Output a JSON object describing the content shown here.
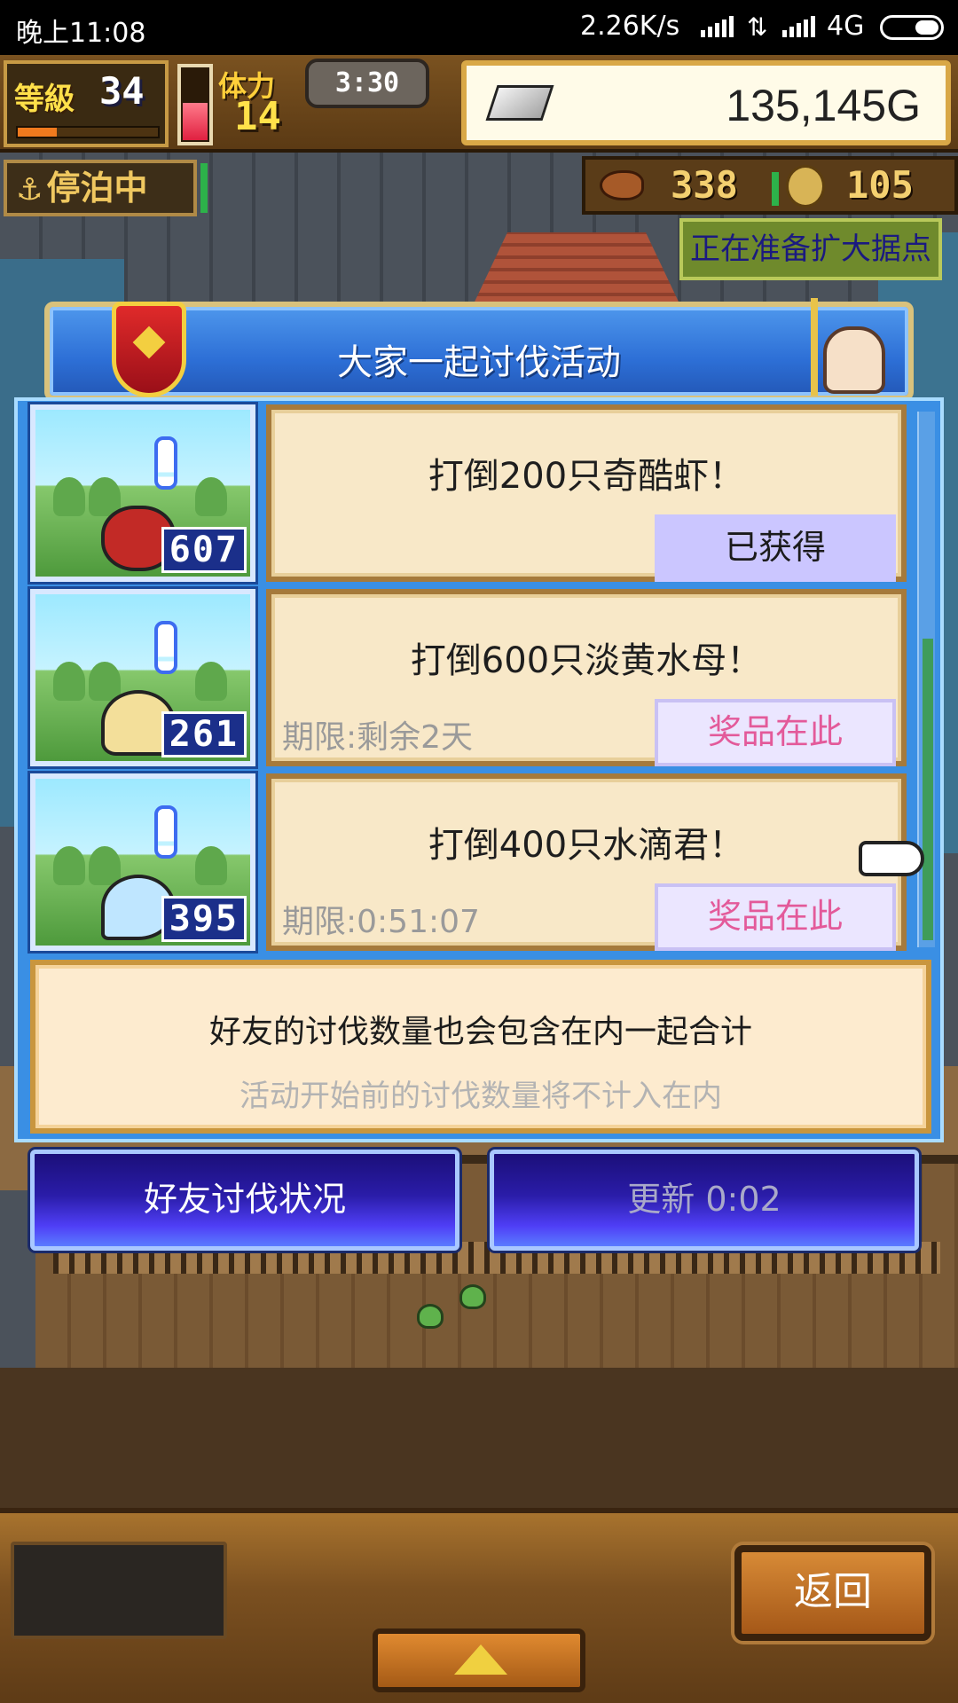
{
  "status_bar": {
    "time": "晚上11:08",
    "net_speed": "2.26K/s",
    "network_type": "4G"
  },
  "hud": {
    "level_label": "等級",
    "level": "34",
    "exp_progress": 0.28,
    "stamina_label": "体力",
    "stamina": "14",
    "stamina_progress": 0.55,
    "stamina_timer": "3:30",
    "gold": "135,145G",
    "docked_label": "停泊中",
    "meat": "338",
    "coins": "105",
    "expand_notice": "正在准备扩大据点"
  },
  "event": {
    "title": "大家一起讨伐活动",
    "missions": [
      {
        "title": "打倒200只奇酷虾！",
        "count": "607",
        "deadline": "",
        "reward_label": "已获得",
        "monster_icon": "shrimp-icon"
      },
      {
        "title": "打倒600只淡黄水母！",
        "count": "261",
        "deadline": "期限:剩余2天",
        "reward_label": "奖品在此",
        "monster_icon": "jellyfish-icon"
      },
      {
        "title": "打倒400只水滴君！",
        "count": "395",
        "deadline": "期限:0:51:07",
        "reward_label": "奖品在此",
        "monster_icon": "water-drop-icon"
      }
    ],
    "info_main": "好友的讨伐数量也会包含在内一起合计",
    "info_sub": "活动开始前的讨伐数量将不计入在内",
    "friends_button": "好友讨伐状况",
    "refresh_button": "更新 0:02"
  },
  "bottom_bar": {
    "back_button": "返回"
  },
  "colors": {
    "dialog_blue": "#3a8fe4",
    "panel_beige": "#f8e8c8",
    "reward_pink": "#e35a9a",
    "reward_obtained_bg": "#cbc6ff"
  }
}
